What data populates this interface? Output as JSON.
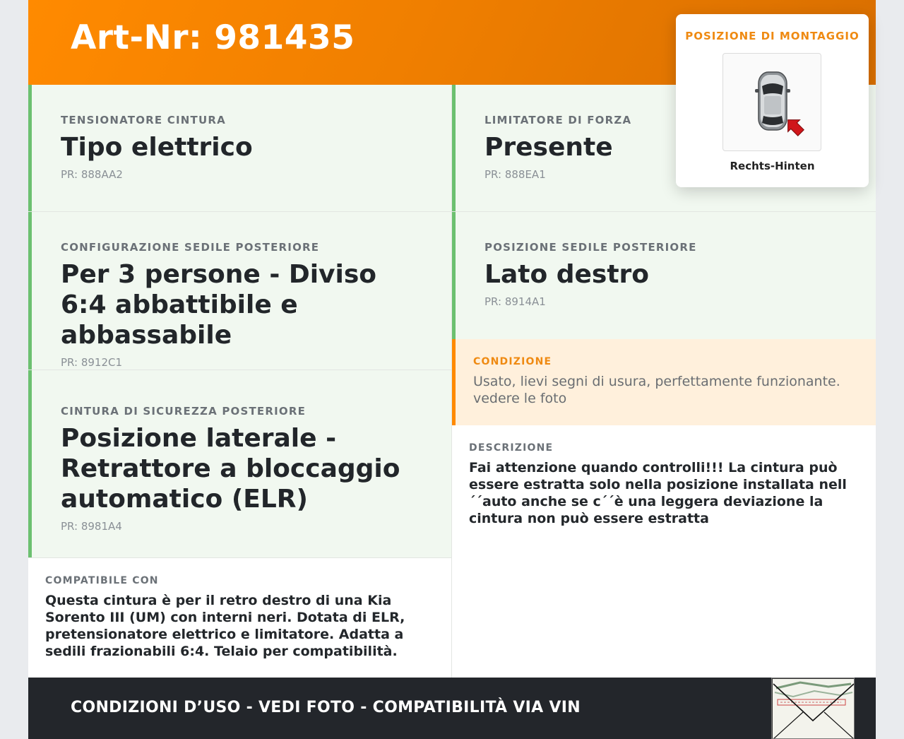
{
  "header": {
    "title": "Art-Nr: 981435"
  },
  "mounting": {
    "label": "POSIZIONE DI MONTAGGIO",
    "position": "Rechts-Hinten",
    "image_icon": "car-top-view-with-red-arrow-rear-right"
  },
  "specs": {
    "tensioner": {
      "label": "TENSIONATORE CINTURA",
      "value": "Tipo elettrico",
      "pr": "PR: 888AA2"
    },
    "force_limiter": {
      "label": "LIMITATORE DI FORZA",
      "value": "Presente",
      "pr": "PR: 888EA1"
    },
    "seat_config": {
      "label": "CONFIGURAZIONE SEDILE POSTERIORE",
      "value": "Per 3 persone - Diviso 6:4 abbattibile e abbassabile",
      "pr": "PR: 8912C1"
    },
    "seat_position": {
      "label": "POSIZIONE SEDILE POSTERIORE",
      "value": "Lato destro",
      "pr": "PR: 8914A1"
    },
    "rear_belt": {
      "label": "CINTURA DI SICUREZZA POSTERIORE",
      "value": "Posizione laterale - Retrattore a bloccaggio automatico (ELR)",
      "pr": "PR: 8981A4"
    }
  },
  "condition": {
    "label": "CONDIZIONE",
    "text": "Usato, lievi segni di usura, perfettamente funzionante. vedere le foto"
  },
  "description": {
    "label": "DESCRIZIONE",
    "text": "Fai attenzione quando controlli!!! La cintura può essere estratta solo nella posizione installata nell´´auto anche se c´´è una leggera deviazione la cintura non può essere estratta"
  },
  "compatibility": {
    "label": "COMPATIBILE CON",
    "text": "Questa cintura è per il retro destro di una Kia Sorento III (UM) con interni neri. Dotata di ELR, pretensionatore elettrico e limitatore. Adatta a sedili frazionabili 6:4. Telaio per compatibilità."
  },
  "footer": {
    "text": "CONDIZIONI D’USO - VEDI FOTO - COMPATIBILITÀ VIA VIN",
    "thumbnail_icon": "vehicle-document-envelope-thumbnail"
  },
  "colors": {
    "accent_orange": "#ff8a00",
    "spec_bg": "#f1f8f0",
    "spec_border": "#6cc070",
    "condition_bg": "#fff0dc",
    "footer_bg": "#23262b"
  }
}
